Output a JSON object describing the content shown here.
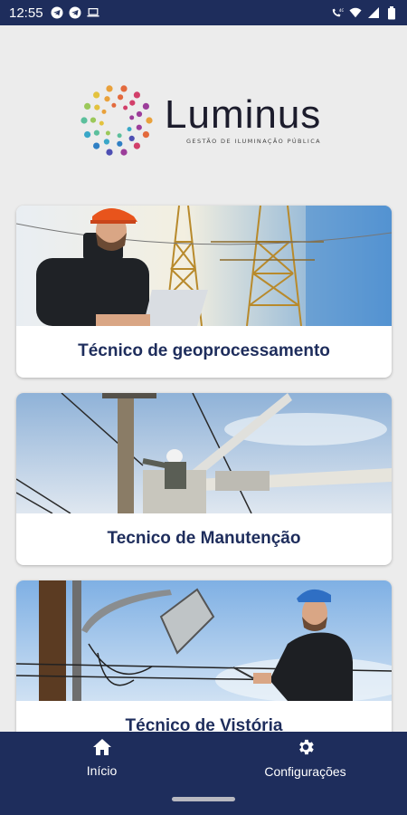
{
  "status_bar": {
    "time": "12:55",
    "left_icons": [
      "telegram-icon",
      "telegram-icon",
      "laptop-icon"
    ],
    "right_icons": [
      "volte-call-icon",
      "wifi-icon",
      "signal-icon",
      "battery-icon"
    ],
    "background": "#1e2d5c"
  },
  "logo": {
    "wordmark": "Luminus",
    "tagline": "GESTÃO DE ILUMINAÇÃO PÚBLICA"
  },
  "cards": [
    {
      "title": "Técnico de geoprocessamento",
      "photo": "technician-with-laptop-and-power-towers"
    },
    {
      "title": "Tecnico de Manutenção",
      "photo": "lineman-on-pole-bucket"
    },
    {
      "title": "Técnico de Vistória",
      "photo": "technician-with-tablet-street-light"
    }
  ],
  "bottom_nav": {
    "items": [
      {
        "label": "Início",
        "icon": "home-icon"
      },
      {
        "label": "Configurações",
        "icon": "gear-icon"
      }
    ]
  },
  "colors": {
    "primary": "#1e2d5c",
    "background": "#ececec",
    "card": "#ffffff"
  }
}
